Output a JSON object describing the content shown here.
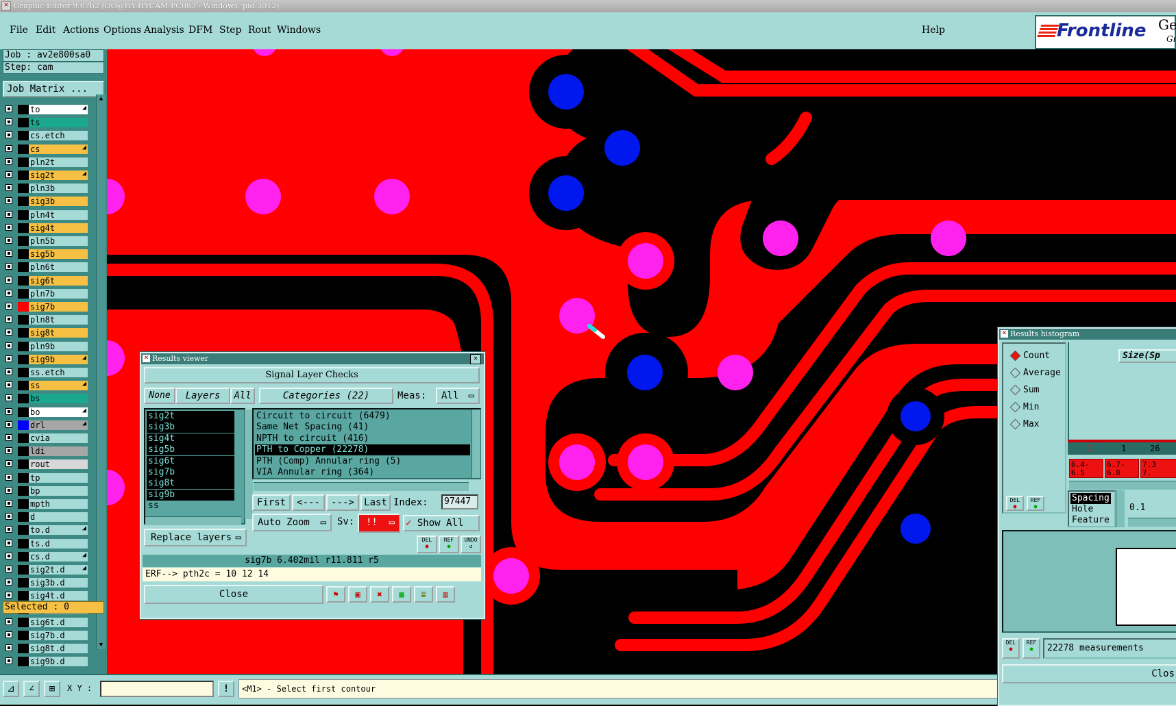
{
  "window": {
    "title": "Graphic Editor 9.07b2 (OO@HY-HYCAM-PC083 - Windows, pid:3012)"
  },
  "menu": {
    "items": [
      "File",
      "Edit",
      "Actions",
      "Options",
      "Analysis",
      "DFM",
      "Step",
      "Rout",
      "Windows"
    ],
    "help": "Help"
  },
  "logo": {
    "brand": "Frontline",
    "product": "Gen",
    "sub": "Gr"
  },
  "job": {
    "job_label": "Job : av2e800sa0",
    "step_label": "Step: cam",
    "matrix_button": "Job Matrix ..."
  },
  "layers": [
    {
      "name": "to",
      "color": "#ffffff",
      "swatch": "#000000",
      "arrow": true
    },
    {
      "name": "ts",
      "color": "#1aa890",
      "swatch": "#000000",
      "arrow": false
    },
    {
      "name": "cs.etch",
      "color": "#a6dad6",
      "swatch": "#000000",
      "arrow": false
    },
    {
      "name": "cs",
      "color": "#f6c044",
      "swatch": "#000000",
      "arrow": true
    },
    {
      "name": "pln2t",
      "color": "#a6dad6",
      "swatch": "#000000",
      "arrow": false
    },
    {
      "name": "sig2t",
      "color": "#f6c044",
      "swatch": "#000000",
      "arrow": true
    },
    {
      "name": "pln3b",
      "color": "#a6dad6",
      "swatch": "#000000",
      "arrow": false
    },
    {
      "name": "sig3b",
      "color": "#f6c044",
      "swatch": "#000000",
      "arrow": false
    },
    {
      "name": "pln4t",
      "color": "#a6dad6",
      "swatch": "#000000",
      "arrow": false
    },
    {
      "name": "sig4t",
      "color": "#f6c044",
      "swatch": "#000000",
      "arrow": false
    },
    {
      "name": "pln5b",
      "color": "#a6dad6",
      "swatch": "#000000",
      "arrow": false
    },
    {
      "name": "sig5b",
      "color": "#f6c044",
      "swatch": "#000000",
      "arrow": false
    },
    {
      "name": "pln6t",
      "color": "#a6dad6",
      "swatch": "#000000",
      "arrow": false
    },
    {
      "name": "sig6t",
      "color": "#f6c044",
      "swatch": "#000000",
      "arrow": false
    },
    {
      "name": "pln7b",
      "color": "#a6dad6",
      "swatch": "#000000",
      "arrow": false
    },
    {
      "name": "sig7b",
      "color": "#f6c044",
      "swatch": "#ff0000",
      "arrow": false
    },
    {
      "name": "pln8t",
      "color": "#a6dad6",
      "swatch": "#000000",
      "arrow": false
    },
    {
      "name": "sig8t",
      "color": "#f6c044",
      "swatch": "#000000",
      "arrow": false
    },
    {
      "name": "pln9b",
      "color": "#a6dad6",
      "swatch": "#000000",
      "arrow": false
    },
    {
      "name": "sig9b",
      "color": "#f6c044",
      "swatch": "#000000",
      "arrow": true
    },
    {
      "name": "ss.etch",
      "color": "#a6dad6",
      "swatch": "#000000",
      "arrow": false
    },
    {
      "name": "ss",
      "color": "#f6c044",
      "swatch": "#000000",
      "arrow": true
    },
    {
      "name": "bs",
      "color": "#1aa890",
      "swatch": "#000000",
      "arrow": false
    },
    {
      "name": "bo",
      "color": "#ffffff",
      "swatch": "#000000",
      "arrow": true
    },
    {
      "name": "drl",
      "color": "#a6a6a6",
      "swatch": "#0000ff",
      "arrow": true
    },
    {
      "name": "cvia",
      "color": "#a6dad6",
      "swatch": "#000000",
      "arrow": false
    },
    {
      "name": "ldi",
      "color": "#a6a6a6",
      "swatch": "#000000",
      "arrow": false
    },
    {
      "name": "rout",
      "color": "#d8d8d8",
      "swatch": "#000000",
      "arrow": false
    },
    {
      "name": "tp",
      "color": "#a6dad6",
      "swatch": "#000000",
      "arrow": false
    },
    {
      "name": "bp",
      "color": "#a6dad6",
      "swatch": "#000000",
      "arrow": false
    },
    {
      "name": "mpth",
      "color": "#a6dad6",
      "swatch": "#000000",
      "arrow": false
    },
    {
      "name": "d",
      "color": "#a6dad6",
      "swatch": "#000000",
      "arrow": false
    },
    {
      "name": "to.d",
      "color": "#a6dad6",
      "swatch": "#000000",
      "arrow": true
    },
    {
      "name": "ts.d",
      "color": "#a6dad6",
      "swatch": "#000000",
      "arrow": false
    },
    {
      "name": "cs.d",
      "color": "#a6dad6",
      "swatch": "#000000",
      "arrow": true
    },
    {
      "name": "sig2t.d",
      "color": "#a6dad6",
      "swatch": "#000000",
      "arrow": true
    },
    {
      "name": "sig3b.d",
      "color": "#a6dad6",
      "swatch": "#000000",
      "arrow": false
    },
    {
      "name": "sig4t.d",
      "color": "#a6dad6",
      "swatch": "#000000",
      "arrow": false
    },
    {
      "name": "sig5b.d",
      "color": "#a6dad6",
      "swatch": "#000000",
      "arrow": false
    },
    {
      "name": "sig6t.d",
      "color": "#a6dad6",
      "swatch": "#000000",
      "arrow": false
    },
    {
      "name": "sig7b.d",
      "color": "#a6dad6",
      "swatch": "#000000",
      "arrow": false
    },
    {
      "name": "sig8t.d",
      "color": "#a6dad6",
      "swatch": "#000000",
      "arrow": false
    },
    {
      "name": "sig9b.d",
      "color": "#a6dad6",
      "swatch": "#000000",
      "arrow": false
    }
  ],
  "selected": "Selected : 0",
  "status": {
    "xy_label": "X Y :",
    "bang": "!",
    "message": "<M1> - Select first contour"
  },
  "results_viewer": {
    "title": "Results viewer",
    "header": "Signal Layer Checks",
    "none_btn": "None",
    "layers_btn": "Layers",
    "all_btn": "All",
    "categories_btn": "Categories (22)",
    "meas_label": "Meas:",
    "meas_value": "All",
    "layer_list": [
      "sig2t",
      "sig3b",
      "sig4t",
      "sig5b",
      "sig6t",
      "sig7b",
      "sig8t",
      "sig9b",
      "ss"
    ],
    "category_list": [
      "Circuit to circuit (6479)",
      "Same Net Spacing (41)",
      "NPTH to circuit (416)",
      "PTH to Copper (22278)",
      "PTH (Comp) Annular ring (5)",
      "VIA Annular ring (364)"
    ],
    "selected_category": 3,
    "first_btn": "First",
    "prev_btn": "<---",
    "next_btn": "--->",
    "last_btn": "Last",
    "index_label": "Index:",
    "index_value": "97447",
    "auto_zoom": "Auto Zoom",
    "sv_label": "Sv:",
    "sv_value": "!!",
    "show_all": "Show All",
    "replace_layers": "Replace layers",
    "del_label": "DEL",
    "ref_label": "REF",
    "undo_label": "UNDO",
    "info": "sig7b 6.402mil  r11.811  r5",
    "erf": "ERF--> pth2c = 10 12 14",
    "close": "Close"
  },
  "histogram": {
    "title": "Results histogram",
    "modes": [
      "Count",
      "Average",
      "Sum",
      "Min",
      "Max"
    ],
    "selected_mode": "Count",
    "size_label": "Size(Sp",
    "bin_counts": [
      "1",
      "1",
      "26"
    ],
    "bin_labels": [
      "6.4-\n6.5",
      "6.7-\n6.8",
      "7.3\n7."
    ],
    "attr_list": [
      "Spacing",
      "Hole",
      "Feature"
    ],
    "step_value": "0.1",
    "measurements": "22278 measurements",
    "del_label": "DEL",
    "ref_label": "REF",
    "close_partial": "Clos"
  },
  "colors": {
    "accent": "#a6dad6",
    "dark": "#2b6b66",
    "board": "#ff0000",
    "copper": "#000000",
    "pad": "#ff22ee",
    "via": "#0018ee"
  }
}
